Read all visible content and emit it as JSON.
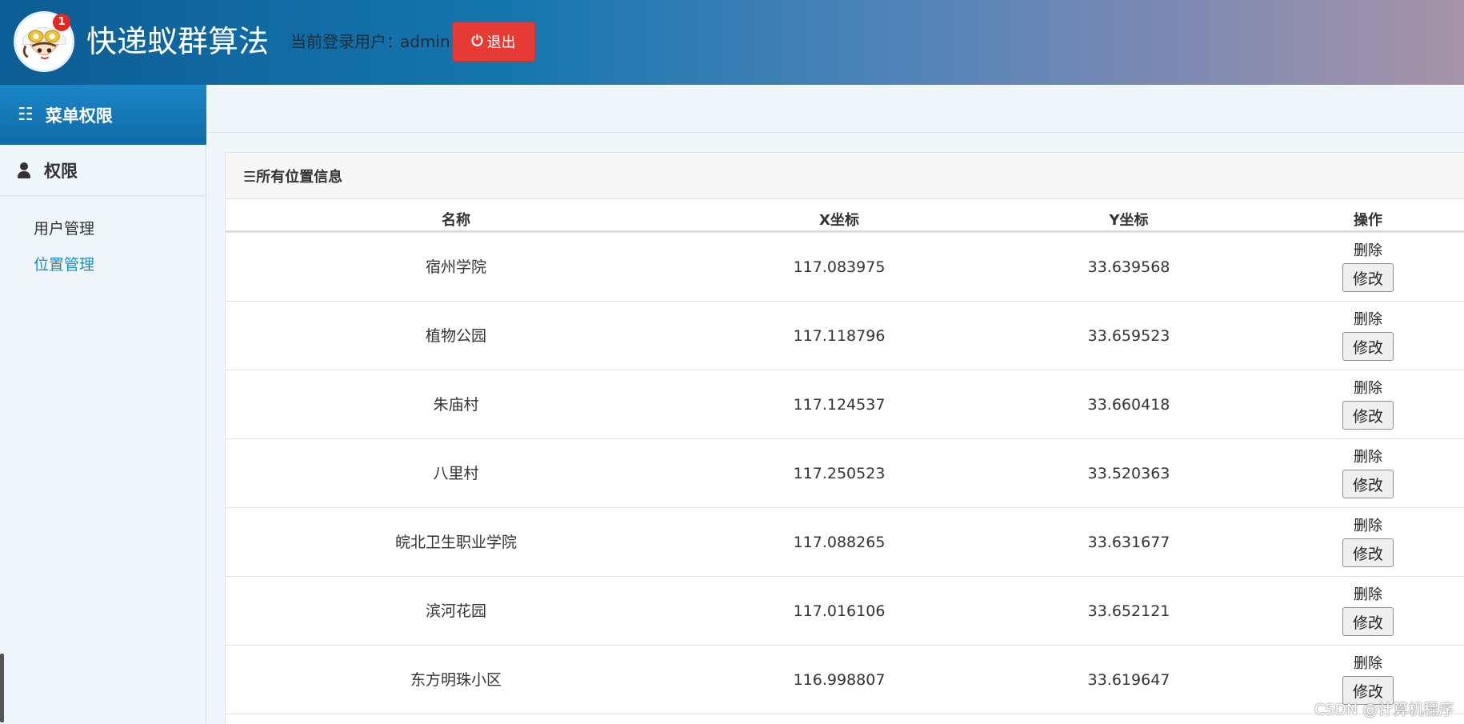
{
  "header": {
    "title": "快递蚁群算法",
    "logged_in_prefix": "当前登录用户：",
    "username": "admin",
    "logout_label": "退出",
    "logo_badge": "1",
    "colors": {
      "accent": "#0f6ba8",
      "logout": "#e63a35"
    }
  },
  "sidebar": {
    "menu_title": "菜单权限",
    "group_title": "权限",
    "items": [
      {
        "label": "用户管理",
        "active": false
      },
      {
        "label": "位置管理",
        "active": true
      }
    ]
  },
  "panel": {
    "title": "☰所有位置信息",
    "columns": [
      "名称",
      "X坐标",
      "Y坐标",
      "操作"
    ],
    "rows": [
      {
        "name": "宿州学院",
        "x": "117.083975",
        "y": "33.639568",
        "delete": "删除",
        "edit": "修改"
      },
      {
        "name": "植物公园",
        "x": "117.118796",
        "y": "33.659523",
        "delete": "删除",
        "edit": "修改"
      },
      {
        "name": "朱庙村",
        "x": "117.124537",
        "y": "33.660418",
        "delete": "删除",
        "edit": "修改"
      },
      {
        "name": "八里村",
        "x": "117.250523",
        "y": "33.520363",
        "delete": "删除",
        "edit": "修改"
      },
      {
        "name": "皖北卫生职业学院",
        "x": "117.088265",
        "y": "33.631677",
        "delete": "删除",
        "edit": "修改"
      },
      {
        "name": "滨河花园",
        "x": "117.016106",
        "y": "33.652121",
        "delete": "删除",
        "edit": "修改"
      },
      {
        "name": "东方明珠小区",
        "x": "116.998807",
        "y": "33.619647",
        "delete": "删除",
        "edit": "修改"
      }
    ]
  },
  "watermark": "CSDN @计算机程序"
}
